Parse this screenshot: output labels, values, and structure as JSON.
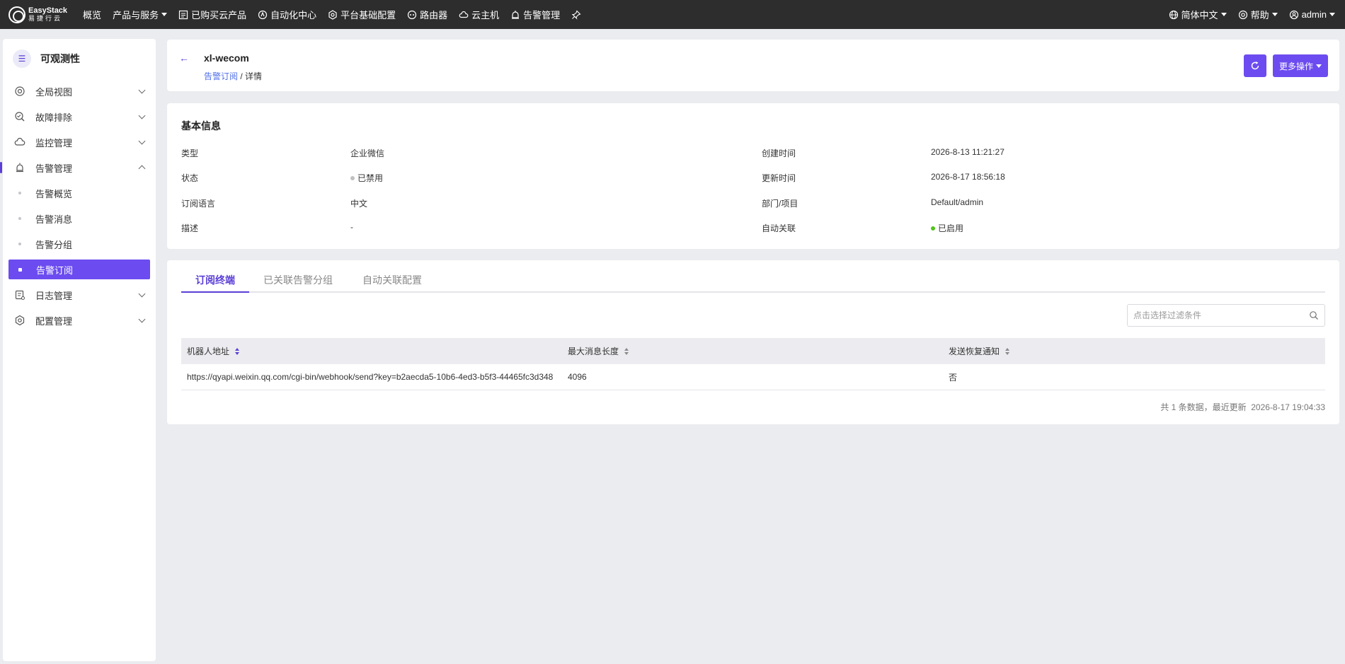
{
  "topbar": {
    "logo_en": "EasyStack",
    "logo_cn": "易捷行云",
    "nav": [
      {
        "icon": "overview",
        "label": "概览",
        "caret": false
      },
      {
        "icon": "products",
        "label": "产品与服务",
        "caret": true
      },
      {
        "icon": "list-icon",
        "label": "已购买云产品",
        "caret": false
      },
      {
        "icon": "automation-icon",
        "label": "自动化中心",
        "caret": false
      },
      {
        "icon": "gear-icon",
        "label": "平台基础配置",
        "caret": false
      },
      {
        "icon": "router-icon",
        "label": "路由器",
        "caret": false
      },
      {
        "icon": "cloud-icon",
        "label": "云主机",
        "caret": false
      },
      {
        "icon": "alarm-icon",
        "label": "告警管理",
        "caret": false
      }
    ],
    "language": "简体中文",
    "help": "帮助",
    "user": "admin"
  },
  "sidebar": {
    "title": "可观测性",
    "items": [
      {
        "label": "全局视图"
      },
      {
        "label": "故障排除"
      },
      {
        "label": "监控管理"
      },
      {
        "label": "告警管理"
      }
    ],
    "subitems": [
      "告警概览",
      "告警消息",
      "告警分组",
      "告警订阅"
    ],
    "items_after": [
      {
        "label": "日志管理"
      },
      {
        "label": "配置管理"
      }
    ]
  },
  "header": {
    "title": "xl-wecom",
    "breadcrumb_link": "告警订阅",
    "breadcrumb_sep": "/",
    "breadcrumb_current": "详情",
    "more_button": "更多操作"
  },
  "info": {
    "title": "基本信息",
    "left": [
      {
        "label": "类型",
        "value": "企业微信"
      },
      {
        "label": "状态",
        "value": "已禁用"
      },
      {
        "label": "订阅语言",
        "value": "中文"
      },
      {
        "label": "描述",
        "value": "-"
      }
    ],
    "right": [
      {
        "label": "创建时间",
        "value": "2026-8-13 11:21:27"
      },
      {
        "label": "更新时间",
        "value": "2026-8-17 18:56:18"
      },
      {
        "label": "部门/项目",
        "value": "Default/admin"
      },
      {
        "label": "自动关联",
        "value": "已启用"
      }
    ],
    "status_colors": {
      "disabled": "#c0c0c0",
      "enabled": "#52c41a"
    }
  },
  "tabs": [
    "订阅终端",
    "已关联告警分组",
    "自动关联配置"
  ],
  "filter": {
    "placeholder": "点击选择过滤条件"
  },
  "table": {
    "columns": [
      "机器人地址",
      "最大消息长度",
      "发送恢复通知"
    ],
    "rows": [
      [
        "https://qyapi.weixin.qq.com/cgi-bin/webhook/send?key=b2aecda5-10b6-4ed3-b5f3-44465fc3d348",
        "4096",
        "否"
      ]
    ]
  },
  "footer": "共 1 条数据，最近更新  2026-8-17 19:04:33",
  "accent": "#6c4cf0"
}
